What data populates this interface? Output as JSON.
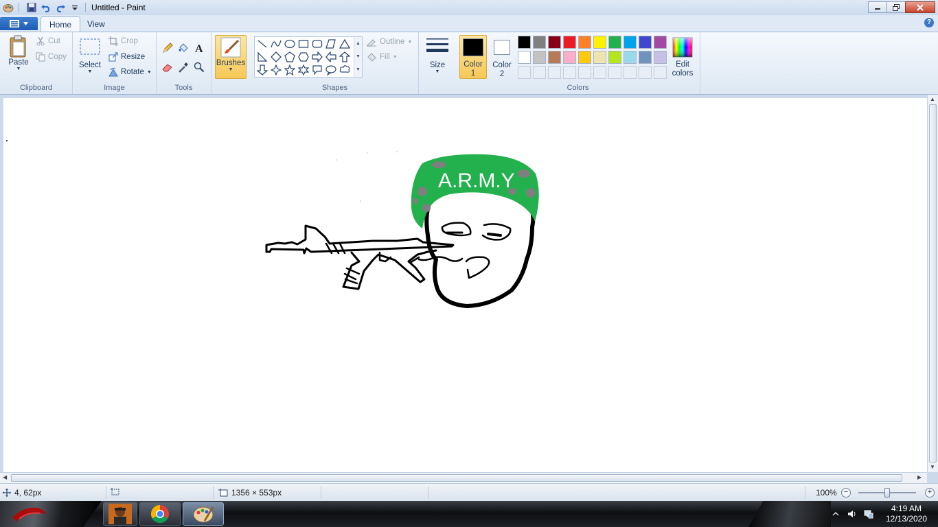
{
  "window": {
    "title": "Untitled - Paint"
  },
  "tabs": {
    "home": "Home",
    "view": "View"
  },
  "clipboard": {
    "paste": "Paste",
    "cut": "Cut",
    "copy": "Copy",
    "label": "Clipboard"
  },
  "image": {
    "select": "Select",
    "crop": "Crop",
    "resize": "Resize",
    "rotate": "Rotate",
    "label": "Image"
  },
  "tools": {
    "label": "Tools"
  },
  "brushes": {
    "label": "Brushes"
  },
  "shapes": {
    "outline": "Outline",
    "fill": "Fill",
    "label": "Shapes"
  },
  "size": {
    "label": "Size"
  },
  "colors": {
    "color1_line1": "Color",
    "color1_line2": "1",
    "color2_line1": "Color",
    "color2_line2": "2",
    "edit_line1": "Edit",
    "edit_line2": "colors",
    "label": "Colors",
    "color1_value": "#000000",
    "color2_value": "#ffffff",
    "palette_row1": [
      "#000000",
      "#7f7f7f",
      "#880015",
      "#ed1c24",
      "#ff7f27",
      "#fff200",
      "#22b14c",
      "#00a2e8",
      "#3f48cc",
      "#a349a4"
    ],
    "palette_row2": [
      "#ffffff",
      "#c3c3c3",
      "#b97a57",
      "#ffaec9",
      "#ffc90e",
      "#efe4b0",
      "#b5e61d",
      "#99d9ea",
      "#7092be",
      "#c8bfe7"
    ]
  },
  "drawing": {
    "hat_text": "A.R.M.Y",
    "hat_color": "#22b14c",
    "spot_color": "#7f7f7f"
  },
  "status": {
    "cursor_pos": "4, 62px",
    "canvas_size": "1356 × 553px",
    "zoom": "100%"
  },
  "taskbar": {
    "time": "4:19 AM",
    "date": "12/13/2020"
  }
}
